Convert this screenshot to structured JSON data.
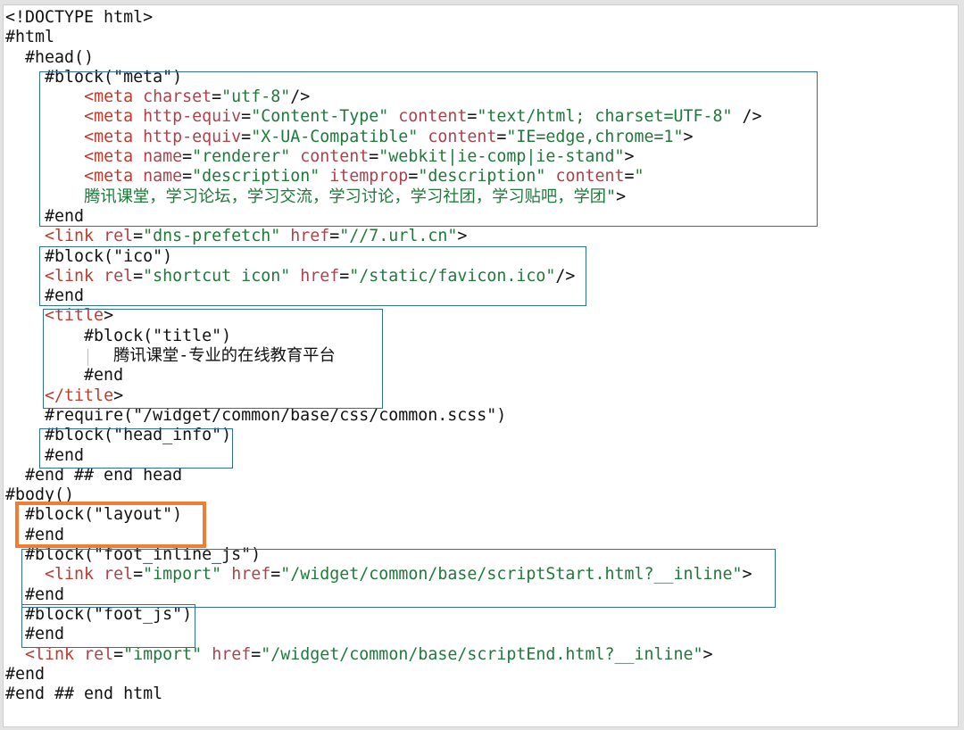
{
  "colors": {
    "text": "#111111",
    "tag": "#c0392b",
    "attribute": "#b0404a",
    "string": "#1f7a3a",
    "block_outline": "#2f6ea3",
    "highlight_outline": "#ef7d32",
    "background": "#ffffff"
  },
  "code_lines": [
    [
      {
        "t": "<!DOCTYPE html>",
        "k": "plain"
      }
    ],
    [
      {
        "t": "#html",
        "k": "plain"
      }
    ],
    [
      {
        "t": "  #head()",
        "k": "plain"
      }
    ],
    [
      {
        "t": "    #block(\"meta\")",
        "k": "plain"
      }
    ],
    [
      {
        "t": "        ",
        "k": "plain"
      },
      {
        "t": "<meta",
        "k": "tag"
      },
      {
        "t": " ",
        "k": "plain"
      },
      {
        "t": "charset",
        "k": "attr"
      },
      {
        "t": "=",
        "k": "plain"
      },
      {
        "t": "\"utf-8\"",
        "k": "str"
      },
      {
        "t": "/>",
        "k": "plain"
      }
    ],
    [
      {
        "t": "        ",
        "k": "plain"
      },
      {
        "t": "<meta",
        "k": "tag"
      },
      {
        "t": " ",
        "k": "plain"
      },
      {
        "t": "http-equiv",
        "k": "attr"
      },
      {
        "t": "=",
        "k": "plain"
      },
      {
        "t": "\"Content-Type\"",
        "k": "str"
      },
      {
        "t": " ",
        "k": "plain"
      },
      {
        "t": "content",
        "k": "attr"
      },
      {
        "t": "=",
        "k": "plain"
      },
      {
        "t": "\"text/html; charset=UTF-8\"",
        "k": "str"
      },
      {
        "t": " />",
        "k": "plain"
      }
    ],
    [
      {
        "t": "        ",
        "k": "plain"
      },
      {
        "t": "<meta",
        "k": "tag"
      },
      {
        "t": " ",
        "k": "plain"
      },
      {
        "t": "http-equiv",
        "k": "attr"
      },
      {
        "t": "=",
        "k": "plain"
      },
      {
        "t": "\"X-UA-Compatible\"",
        "k": "str"
      },
      {
        "t": " ",
        "k": "plain"
      },
      {
        "t": "content",
        "k": "attr"
      },
      {
        "t": "=",
        "k": "plain"
      },
      {
        "t": "\"IE=edge,chrome=1\"",
        "k": "str"
      },
      {
        "t": ">",
        "k": "plain"
      }
    ],
    [
      {
        "t": "        ",
        "k": "plain"
      },
      {
        "t": "<meta",
        "k": "tag"
      },
      {
        "t": " ",
        "k": "plain"
      },
      {
        "t": "name",
        "k": "attr"
      },
      {
        "t": "=",
        "k": "plain"
      },
      {
        "t": "\"renderer\"",
        "k": "str"
      },
      {
        "t": " ",
        "k": "plain"
      },
      {
        "t": "content",
        "k": "attr"
      },
      {
        "t": "=",
        "k": "plain"
      },
      {
        "t": "\"webkit|ie-comp|ie-stand\"",
        "k": "str"
      },
      {
        "t": ">",
        "k": "plain"
      }
    ],
    [
      {
        "t": "        ",
        "k": "plain"
      },
      {
        "t": "<meta",
        "k": "tag"
      },
      {
        "t": " ",
        "k": "plain"
      },
      {
        "t": "name",
        "k": "attr"
      },
      {
        "t": "=",
        "k": "plain"
      },
      {
        "t": "\"description\"",
        "k": "str"
      },
      {
        "t": " ",
        "k": "plain"
      },
      {
        "t": "itemprop",
        "k": "attr"
      },
      {
        "t": "=",
        "k": "plain"
      },
      {
        "t": "\"description\"",
        "k": "str"
      },
      {
        "t": " ",
        "k": "plain"
      },
      {
        "t": "content",
        "k": "attr"
      },
      {
        "t": "=",
        "k": "plain"
      },
      {
        "t": "\"",
        "k": "str"
      }
    ],
    [
      {
        "t": "        ",
        "k": "plain"
      },
      {
        "t": "腾讯课堂，学习论坛，学习交流，学习讨论，学习社团，学习贴吧，学团\"",
        "k": "str"
      },
      {
        "t": ">",
        "k": "plain"
      }
    ],
    [
      {
        "t": "    #end",
        "k": "plain"
      }
    ],
    [
      {
        "t": "    ",
        "k": "plain"
      },
      {
        "t": "<link",
        "k": "tag"
      },
      {
        "t": " ",
        "k": "plain"
      },
      {
        "t": "rel",
        "k": "attr"
      },
      {
        "t": "=",
        "k": "plain"
      },
      {
        "t": "\"dns-prefetch\"",
        "k": "str"
      },
      {
        "t": " ",
        "k": "plain"
      },
      {
        "t": "href",
        "k": "attr"
      },
      {
        "t": "=",
        "k": "plain"
      },
      {
        "t": "\"//7.url.cn\"",
        "k": "str"
      },
      {
        "t": ">",
        "k": "plain"
      }
    ],
    [
      {
        "t": "    #block(\"ico\")",
        "k": "plain"
      }
    ],
    [
      {
        "t": "    ",
        "k": "plain"
      },
      {
        "t": "<link",
        "k": "tag"
      },
      {
        "t": " ",
        "k": "plain"
      },
      {
        "t": "rel",
        "k": "attr"
      },
      {
        "t": "=",
        "k": "plain"
      },
      {
        "t": "\"shortcut icon\"",
        "k": "str"
      },
      {
        "t": " ",
        "k": "plain"
      },
      {
        "t": "href",
        "k": "attr"
      },
      {
        "t": "=",
        "k": "plain"
      },
      {
        "t": "\"/static/favicon.ico\"",
        "k": "str"
      },
      {
        "t": "/>",
        "k": "plain"
      }
    ],
    [
      {
        "t": "    #end",
        "k": "plain"
      }
    ],
    [
      {
        "t": "    ",
        "k": "plain"
      },
      {
        "t": "<title",
        "k": "tag"
      },
      {
        "t": ">",
        "k": "plain"
      }
    ],
    [
      {
        "t": "        #block(\"title\")",
        "k": "plain"
      }
    ],
    [
      {
        "t": "           腾讯课堂-专业的在线教育平台",
        "k": "plain"
      }
    ],
    [
      {
        "t": "        #end",
        "k": "plain"
      }
    ],
    [
      {
        "t": "    ",
        "k": "plain"
      },
      {
        "t": "</title",
        "k": "tag"
      },
      {
        "t": ">",
        "k": "plain"
      }
    ],
    [
      {
        "t": "    #require(\"/widget/common/base/css/common.scss\")",
        "k": "plain"
      }
    ],
    [
      {
        "t": "    #block(\"head_info\")",
        "k": "plain"
      }
    ],
    [
      {
        "t": "    #end",
        "k": "plain"
      }
    ],
    [
      {
        "t": "  #end ## end head",
        "k": "plain"
      }
    ],
    [
      {
        "t": "#body()",
        "k": "plain"
      }
    ],
    [
      {
        "t": "  #block(\"layout\")",
        "k": "plain"
      }
    ],
    [
      {
        "t": "  #end",
        "k": "plain"
      }
    ],
    [
      {
        "t": "  #block(\"foot_inline_js\")",
        "k": "plain"
      }
    ],
    [
      {
        "t": "    ",
        "k": "plain"
      },
      {
        "t": "<link",
        "k": "tag"
      },
      {
        "t": " ",
        "k": "plain"
      },
      {
        "t": "rel",
        "k": "attr"
      },
      {
        "t": "=",
        "k": "plain"
      },
      {
        "t": "\"import\"",
        "k": "str"
      },
      {
        "t": " ",
        "k": "plain"
      },
      {
        "t": "href",
        "k": "attr"
      },
      {
        "t": "=",
        "k": "plain"
      },
      {
        "t": "\"/widget/common/base/scriptStart.html?__inline\"",
        "k": "str"
      },
      {
        "t": ">",
        "k": "plain"
      }
    ],
    [
      {
        "t": "  #end",
        "k": "plain"
      }
    ],
    [
      {
        "t": "  #block(\"foot_js\")",
        "k": "plain"
      }
    ],
    [
      {
        "t": "  #end",
        "k": "plain"
      }
    ],
    [
      {
        "t": "  ",
        "k": "plain"
      },
      {
        "t": "<link",
        "k": "tag"
      },
      {
        "t": " ",
        "k": "plain"
      },
      {
        "t": "rel",
        "k": "attr"
      },
      {
        "t": "=",
        "k": "plain"
      },
      {
        "t": "\"import\"",
        "k": "str"
      },
      {
        "t": " ",
        "k": "plain"
      },
      {
        "t": "href",
        "k": "attr"
      },
      {
        "t": "=",
        "k": "plain"
      },
      {
        "t": "\"/widget/common/base/scriptEnd.html?__inline\"",
        "k": "str"
      },
      {
        "t": ">",
        "k": "plain"
      }
    ],
    [
      {
        "t": "#end",
        "k": "plain"
      }
    ],
    [
      {
        "t": "#end ## end html",
        "k": "plain"
      }
    ]
  ]
}
